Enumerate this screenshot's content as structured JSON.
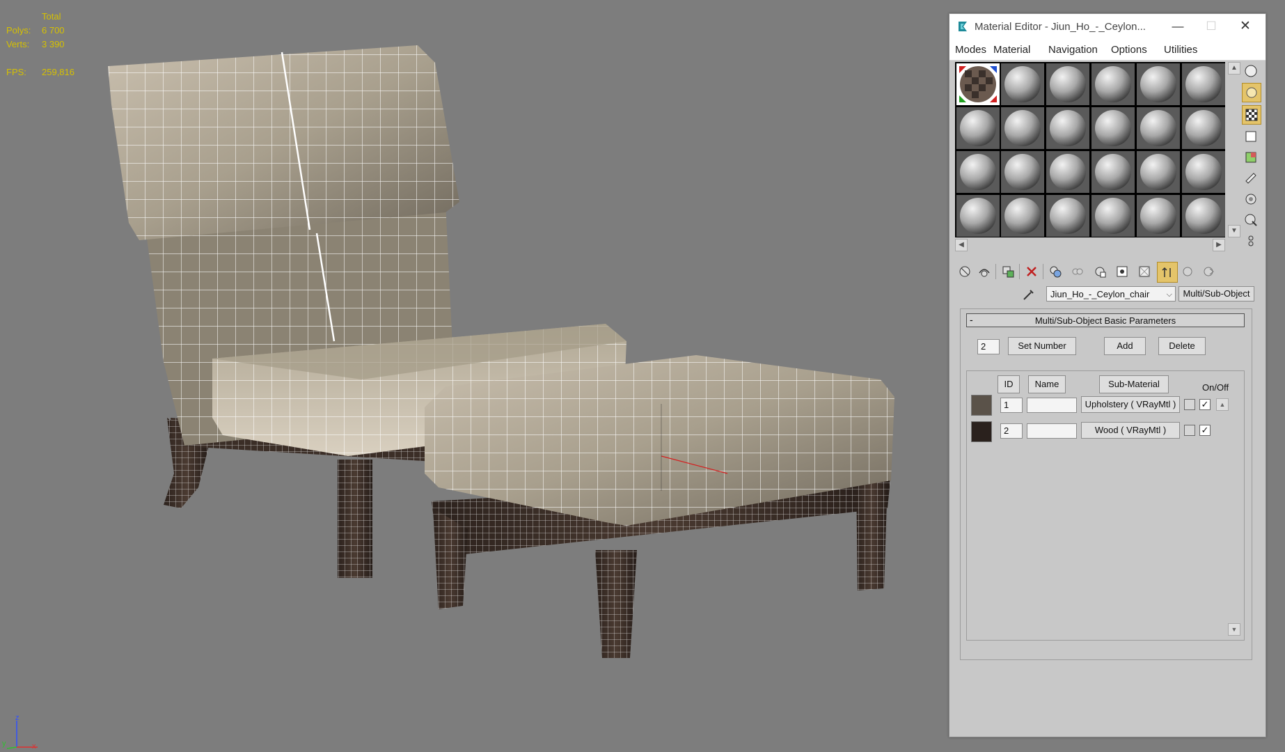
{
  "viewport": {
    "stats": [
      {
        "label": "",
        "value": "Total"
      },
      {
        "label": "Polys:",
        "value": "6 700"
      },
      {
        "label": "Verts:",
        "value": "3 390"
      },
      {
        "label": "",
        "value": ""
      },
      {
        "label": "FPS:",
        "value": "259,816"
      }
    ],
    "axis": {
      "x": "x",
      "y": "y",
      "z": "z"
    }
  },
  "material_editor": {
    "title": "Material Editor - Jiun_Ho_-_Ceylon...",
    "window_buttons": {
      "minimize": "—",
      "maximize": "☐",
      "close": "✕"
    },
    "menu": [
      "Modes",
      "Material",
      "Navigation",
      "Options",
      "Utilities"
    ],
    "material_name": "Jiun_Ho_-_Ceylon_chair",
    "material_type": "Multi/Sub-Object",
    "rollout": {
      "collapse_symbol": "-",
      "title": "Multi/Sub-Object Basic Parameters",
      "count_value": "2",
      "set_number": "Set Number",
      "add": "Add",
      "delete": "Delete",
      "headers": {
        "id": "ID",
        "name": "Name",
        "sub_material": "Sub-Material",
        "on_off": "On/Off"
      },
      "rows": [
        {
          "id": "1",
          "name": "",
          "sub_material": "Upholstery  ( VRayMtl )",
          "checked": "✓",
          "swatch_color": "#5a5249"
        },
        {
          "id": "2",
          "name": "",
          "sub_material": "Wood  ( VRayMtl )",
          "checked": "✓",
          "swatch_color": "#2a211d"
        }
      ]
    }
  }
}
